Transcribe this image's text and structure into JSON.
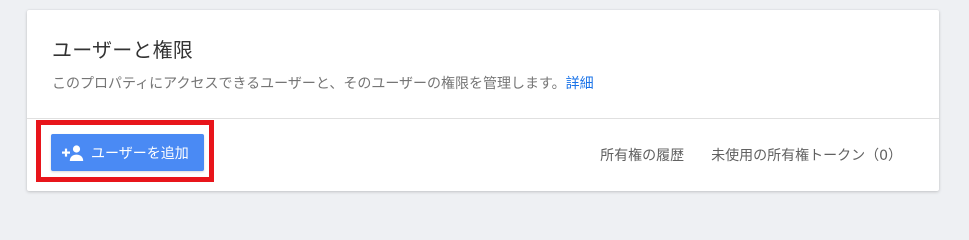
{
  "panel": {
    "title": "ユーザーと権限",
    "description": "このプロパティにアクセスできるユーザーと、そのユーザーの権限を管理します。",
    "learn_more_label": "詳細"
  },
  "toolbar": {
    "add_user_label": "ユーザーを追加",
    "add_user_icon": "person-add-icon",
    "ownership_history_label": "所有権の履歴",
    "unused_tokens_label": "未使用の所有権トークン（0）"
  },
  "colors": {
    "accent": "#4a8af4",
    "link": "#1a73e8",
    "highlight": "#e8151b",
    "background": "#eef0f3"
  }
}
